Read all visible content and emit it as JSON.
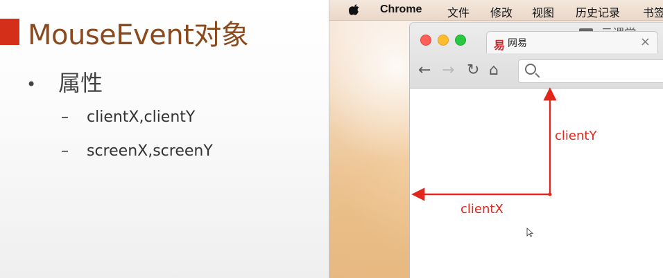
{
  "slide": {
    "title": "MouseEvent对象",
    "bullet_1": "属性",
    "items": [
      "clientX,clientY",
      "screenX,screenY"
    ],
    "title_color": "#8a4a1d",
    "accent_color": "#d43019"
  },
  "mac": {
    "app_name": "Chrome",
    "menu": [
      "文件",
      "修改",
      "视图",
      "历史记录",
      "书签"
    ]
  },
  "browser": {
    "tab_title": "网易",
    "watermark": "云课堂"
  },
  "annotation": {
    "client_x_label": "clientX",
    "client_y_label": "clientY",
    "color": "#e1261c"
  },
  "icons": {
    "apple": "apple-icon",
    "back": "back-arrow-icon",
    "forward": "forward-arrow-icon",
    "reload": "reload-icon",
    "home": "home-icon",
    "search": "search-icon",
    "close": "close-icon",
    "cursor": "mouse-cursor-icon"
  }
}
